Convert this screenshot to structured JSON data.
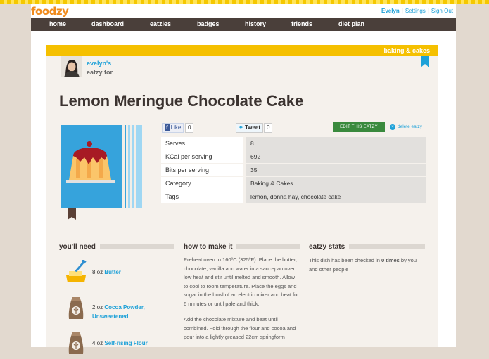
{
  "brand": {
    "logo": "foodzy"
  },
  "user_menu": {
    "username": "Evelyn",
    "settings": "Settings",
    "signout": "Sign Out"
  },
  "nav": {
    "items": [
      "home",
      "dashboard",
      "eatzies",
      "badges",
      "history",
      "friends",
      "diet plan"
    ]
  },
  "card": {
    "category_tag": "baking & cakes",
    "owner": "evelyn's",
    "owner_suffix": "eatzy for",
    "title": "Lemon Meringue Chocolate Cake"
  },
  "social": {
    "like_label": "Like",
    "like_count": "0",
    "tweet_label": "Tweet",
    "tweet_count": "0"
  },
  "actions": {
    "edit": "EDIT THIS EATZY",
    "delete": "delete eatzy"
  },
  "info": [
    {
      "key": "Serves",
      "value": "8"
    },
    {
      "key": "KCal per serving",
      "value": "692"
    },
    {
      "key": "Bits per serving",
      "value": "35"
    },
    {
      "key": "Category",
      "value": "Baking & Cakes"
    },
    {
      "key": "Tags",
      "value": "lemon, donna hay, chocolate cake"
    }
  ],
  "sections": {
    "need": "you'll need",
    "how": "how to make it",
    "stats": "eatzy stats"
  },
  "ingredients": [
    {
      "qty": "8 oz",
      "name": "Butter",
      "icon": "butter-icon"
    },
    {
      "qty": "2 oz",
      "name": "Cocoa Powder, Unsweetened",
      "icon": "flour-sack-icon"
    },
    {
      "qty": "4 oz",
      "name": "Self-rising Flour",
      "icon": "flour-sack-icon"
    }
  ],
  "method": [
    "Preheat oven to 160ºC (325ºF). Place the butter, chocolate, vanilla and water in a saucepan over low heat and stir until melted and smooth. Allow to cool to room temperature. Place the eggs and sugar in the bowl of an electric mixer and beat for 6 minutes or until pale and thick.",
    "Add the chocolate mixture and beat until combined. Fold through the flour and cocoa and pour into a lightly greased 22cm springform"
  ],
  "stats": {
    "prefix": "This dish has been checked in ",
    "times": "0 times",
    "suffix": " by you and other people"
  },
  "colors": {
    "accent": "#f5c000",
    "link": "#1ea1d8",
    "nav_bg": "#4a3f3a",
    "logo": "#f08b1d",
    "edit_button": "#3a8a3d"
  }
}
